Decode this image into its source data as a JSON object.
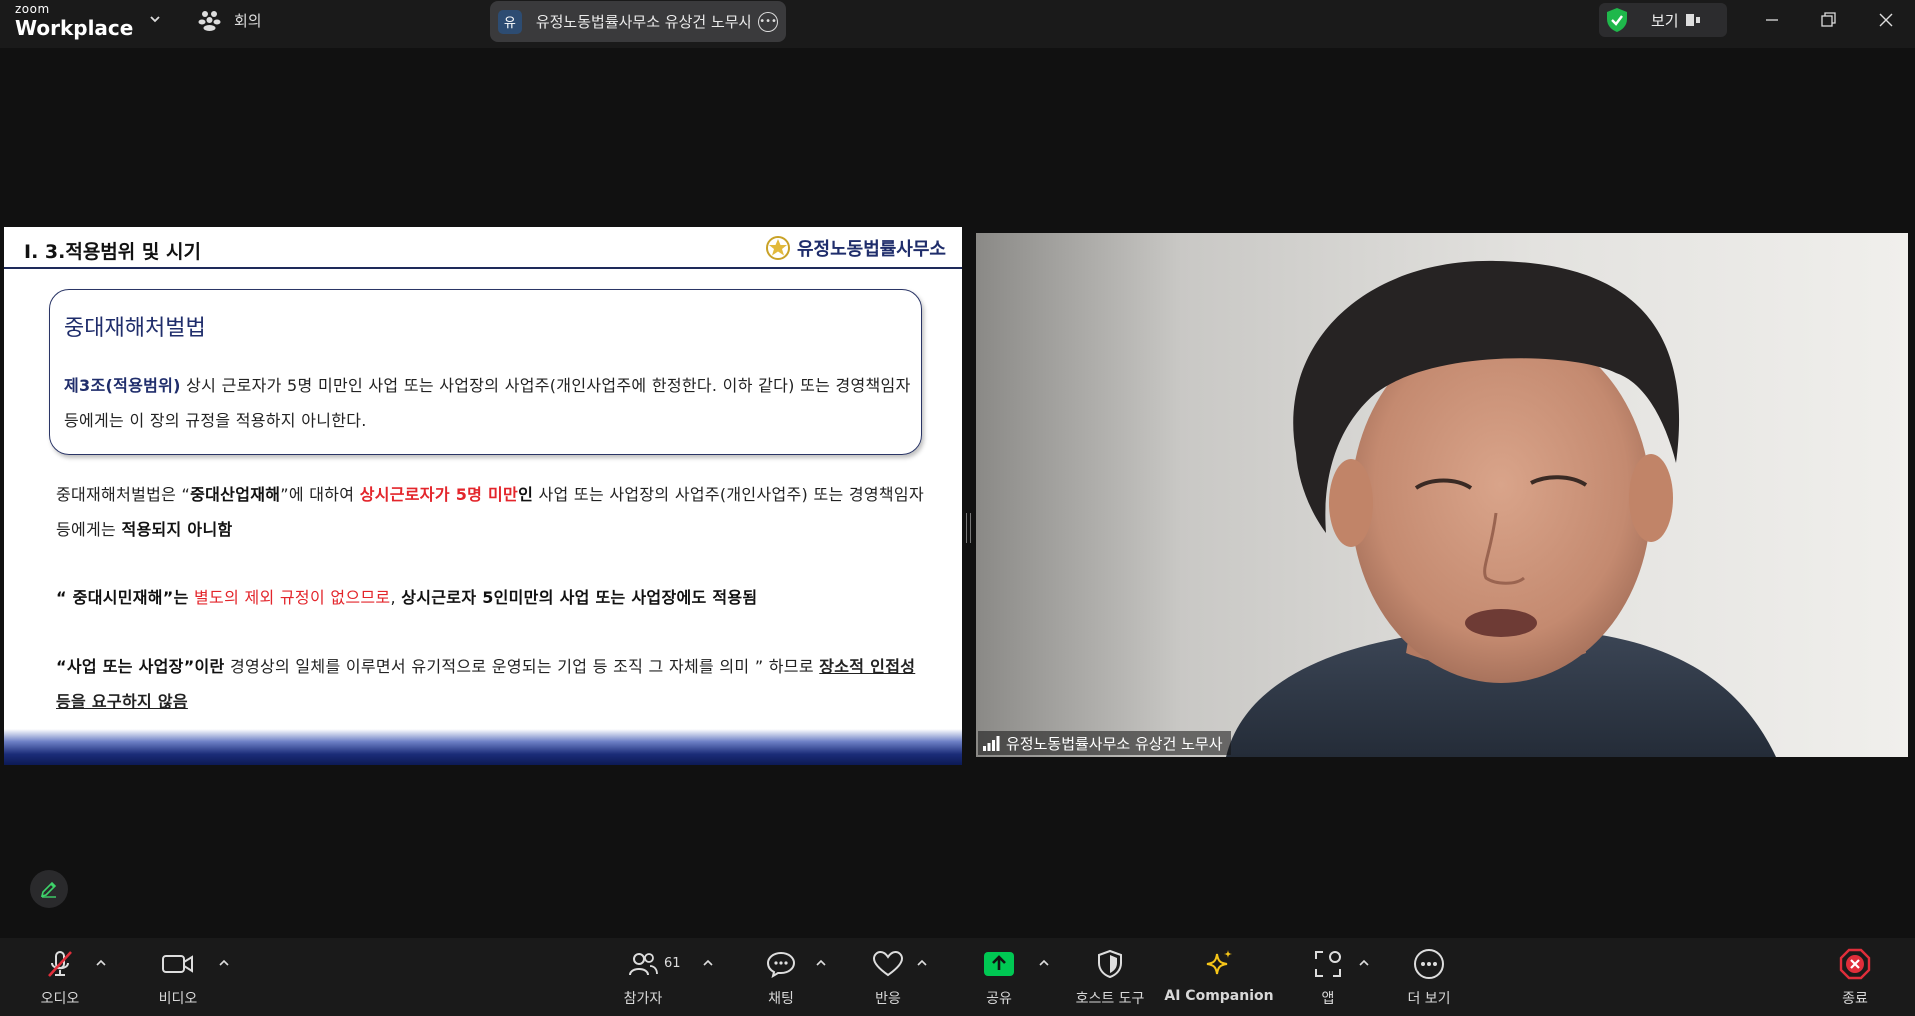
{
  "app": {
    "logo_top": "zoom",
    "logo_bottom": "Workplace",
    "meetings_label": "회의"
  },
  "meeting": {
    "avatar_letter": "유",
    "title": "유정노동법률사무소 유상건 노무사",
    "view_label": "보기"
  },
  "slide": {
    "section_title": "Ⅰ. 3.적용범위 및 시기",
    "firm_name": "유정노동법률사무소",
    "law_name": "중대재해처벌법",
    "article_label": "제3조(적용범위)",
    "article_text": " 상시 근로자가 5명 미만인 사업 또는 사업장의 사업주(개인사업주에 한정한다. 이하 같다) 또는 경영책임자등에게는 이 장의 규정을 적용하지 아니한다.",
    "p1": {
      "a": "중대재해처벌법은 “",
      "b": "중대산업재해",
      "c": "”에 대하여 ",
      "d": "상시근로자가 5명 미만",
      "e": "인",
      "f": " 사업 또는 사업장의 사업주(개인사업주) 또는 경영책임자등에게는 ",
      "g": "적용되지 아니함"
    },
    "p2": {
      "a": " “ 중대시민재해”는",
      "b": " 별도의 제외 규정이 없으므로",
      "c": ", ",
      "d": "상시근로자 5인미만의 사업 또는 사업장에도 적용됨"
    },
    "p3": {
      "a": "“사업 또는 사업장”이란",
      "b": " 경영상의 일체를 이루면서 유기적으로 운영되는 기업 등 조직 그 자체를 의미 ” 하므로 ",
      "c": "장소적 인접성 등을 요구하지 않음"
    }
  },
  "video": {
    "participant_name": "유정노동법률사무소 유상건 노무사"
  },
  "toolbar": {
    "audio": "오디오",
    "video": "비디오",
    "participants": "참가자",
    "participants_count": "61",
    "chat": "채팅",
    "reactions": "반응",
    "share": "공유",
    "host_tools": "호스트 도구",
    "ai_companion": "AI Companion",
    "apps": "앱",
    "more": "더 보기",
    "end": "종료"
  },
  "colors": {
    "background": "#111111",
    "share_green": "#00c853",
    "end_red": "#e02e3a",
    "ai_yellow": "#f5c518",
    "slide_navy": "#1f2d6b",
    "slide_red": "#e3252b"
  }
}
